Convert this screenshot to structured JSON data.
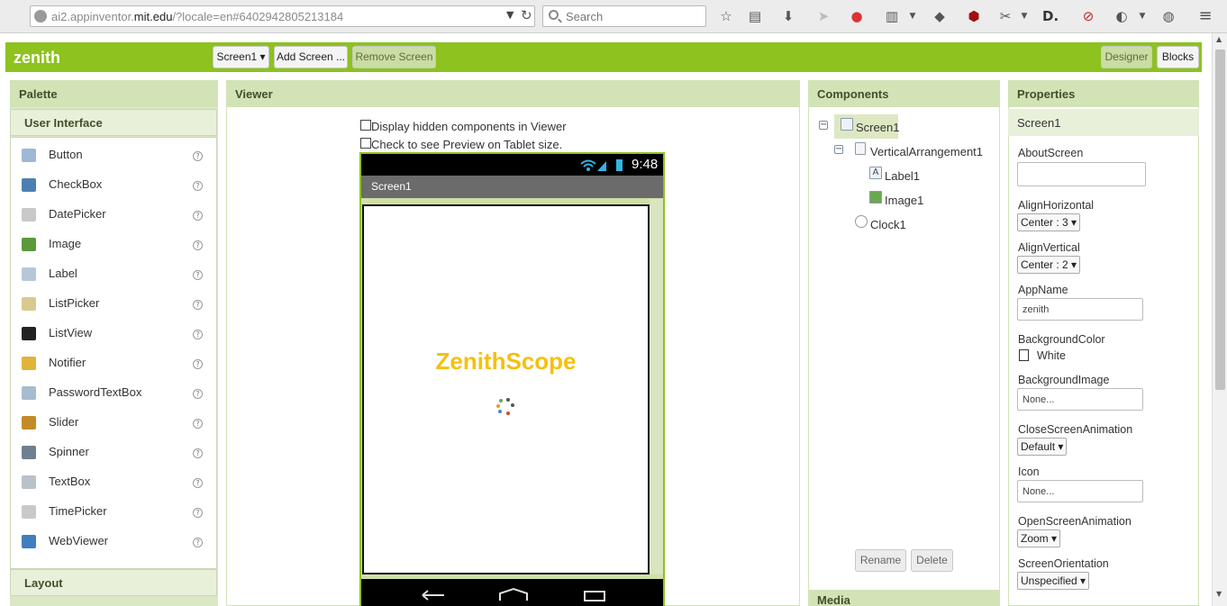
{
  "browser": {
    "url_prefix": "ai2.appinventor.",
    "url_domain": "mit.edu",
    "url_suffix": "/?locale=en#6402942805213184",
    "search_placeholder": "Search"
  },
  "appbar": {
    "app_name": "zenith",
    "screen_select": "Screen1 ▾",
    "add_screen": "Add Screen ...",
    "remove_screen": "Remove Screen",
    "designer": "Designer",
    "blocks": "Blocks"
  },
  "palette": {
    "title": "Palette",
    "section": "User Interface",
    "items": [
      {
        "label": "Button",
        "icon": "button-icon",
        "color": "#9fb8d6"
      },
      {
        "label": "CheckBox",
        "icon": "checkbox-icon",
        "color": "#4d7fb3"
      },
      {
        "label": "DatePicker",
        "icon": "datepicker-icon",
        "color": "#c9c9c9"
      },
      {
        "label": "Image",
        "icon": "image-icon",
        "color": "#5a9a3a"
      },
      {
        "label": "Label",
        "icon": "label-icon",
        "color": "#b7c7d8"
      },
      {
        "label": "ListPicker",
        "icon": "listpicker-icon",
        "color": "#d9c98e"
      },
      {
        "label": "ListView",
        "icon": "listview-icon",
        "color": "#222222"
      },
      {
        "label": "Notifier",
        "icon": "notifier-icon",
        "color": "#e2b33a"
      },
      {
        "label": "PasswordTextBox",
        "icon": "password-icon",
        "color": "#a8bccf"
      },
      {
        "label": "Slider",
        "icon": "slider-icon",
        "color": "#c48a2a"
      },
      {
        "label": "Spinner",
        "icon": "spinner-icon",
        "color": "#6f7f90"
      },
      {
        "label": "TextBox",
        "icon": "textbox-icon",
        "color": "#b9c1c9"
      },
      {
        "label": "TimePicker",
        "icon": "timepicker-icon",
        "color": "#c9c9c9"
      },
      {
        "label": "WebViewer",
        "icon": "webviewer-icon",
        "color": "#3f7fbf"
      }
    ],
    "layout_section": "Layout",
    "help": "?"
  },
  "viewer": {
    "title": "Viewer",
    "hidden_label": "Display hidden components in Viewer",
    "tablet_label": "Check to see Preview on Tablet size.",
    "clock": "9:48",
    "screen_title": "Screen1",
    "app_title": "ZenithScope"
  },
  "components": {
    "title": "Components",
    "tree": [
      "Screen1",
      "VerticalArrangement1",
      "Label1",
      "Image1",
      "Clock1"
    ],
    "rename": "Rename",
    "delete": "Delete",
    "media_partial": "Media"
  },
  "properties": {
    "title": "Properties",
    "component": "Screen1",
    "about_label": "AboutScreen",
    "align_h_label": "AlignHorizontal",
    "align_h_value": "Center : 3 ▾",
    "align_v_label": "AlignVertical",
    "align_v_value": "Center : 2 ▾",
    "appname_label": "AppName",
    "appname_value": "zenith",
    "bgcolor_label": "BackgroundColor",
    "bgcolor_value": "White",
    "bgimage_label": "BackgroundImage",
    "bgimage_value": "None...",
    "close_anim_label": "CloseScreenAnimation",
    "close_anim_value": "Default ▾",
    "icon_label": "Icon",
    "icon_value": "None...",
    "open_anim_label": "OpenScreenAnimation",
    "open_anim_value": "Zoom ▾",
    "orientation_label": "ScreenOrientation",
    "orientation_value": "Unspecified ▾"
  },
  "colors": {
    "accent": "#8dc21f",
    "pane_header": "#d2e3b6",
    "title_color": "#f5c00f"
  }
}
